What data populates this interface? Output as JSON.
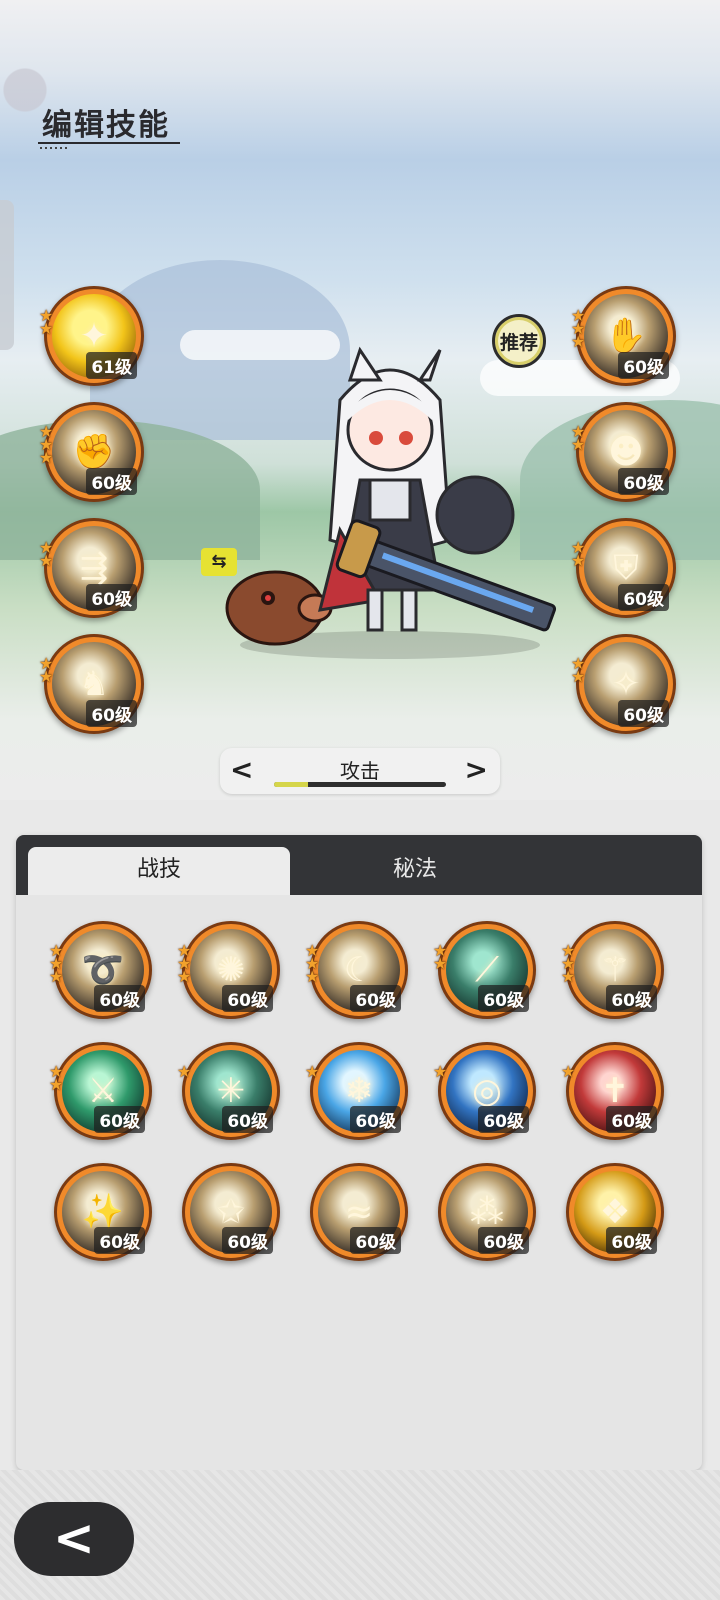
{
  "header": {
    "title": "编辑技能"
  },
  "recommend_label": "推荐",
  "swap_icon": "⇆",
  "left_skills": [
    {
      "level": "61级",
      "stars": 2,
      "glyph": "✦"
    },
    {
      "level": "60级",
      "stars": 3,
      "glyph": "✊"
    },
    {
      "level": "60级",
      "stars": 2,
      "glyph": "⇶"
    },
    {
      "level": "60级",
      "stars": 2,
      "glyph": "♞"
    }
  ],
  "right_skills": [
    {
      "level": "60级",
      "stars": 3,
      "glyph": "✋"
    },
    {
      "level": "60级",
      "stars": 2,
      "glyph": "☻"
    },
    {
      "level": "60级",
      "stars": 2,
      "glyph": "⛨"
    },
    {
      "level": "60级",
      "stars": 2,
      "glyph": "✧"
    }
  ],
  "selector": {
    "prev": "<",
    "label": "攻击",
    "next": ">",
    "progress": 0.2
  },
  "tabs": {
    "active": "战技",
    "inactive": "秘法"
  },
  "grid_skills": [
    {
      "level": "60级",
      "stars": 3,
      "glyph": "➰"
    },
    {
      "level": "60级",
      "stars": 3,
      "glyph": "✺"
    },
    {
      "level": "60级",
      "stars": 3,
      "glyph": "☾"
    },
    {
      "level": "60级",
      "stars": 2,
      "glyph": "⟋"
    },
    {
      "level": "60级",
      "stars": 3,
      "glyph": "⚚"
    },
    {
      "level": "60级",
      "stars": 2,
      "glyph": "⚔"
    },
    {
      "level": "60级",
      "stars": 1,
      "glyph": "✳"
    },
    {
      "level": "60级",
      "stars": 1,
      "glyph": "❄"
    },
    {
      "level": "60级",
      "stars": 1,
      "glyph": "◎"
    },
    {
      "level": "60级",
      "stars": 1,
      "glyph": "✝"
    },
    {
      "level": "60级",
      "stars": 0,
      "glyph": "✨"
    },
    {
      "level": "60级",
      "stars": 0,
      "glyph": "✩"
    },
    {
      "level": "60级",
      "stars": 0,
      "glyph": "≈"
    },
    {
      "level": "60级",
      "stars": 0,
      "glyph": "⁂"
    },
    {
      "level": "60级",
      "stars": 0,
      "glyph": "❖"
    }
  ],
  "back_label": "<"
}
